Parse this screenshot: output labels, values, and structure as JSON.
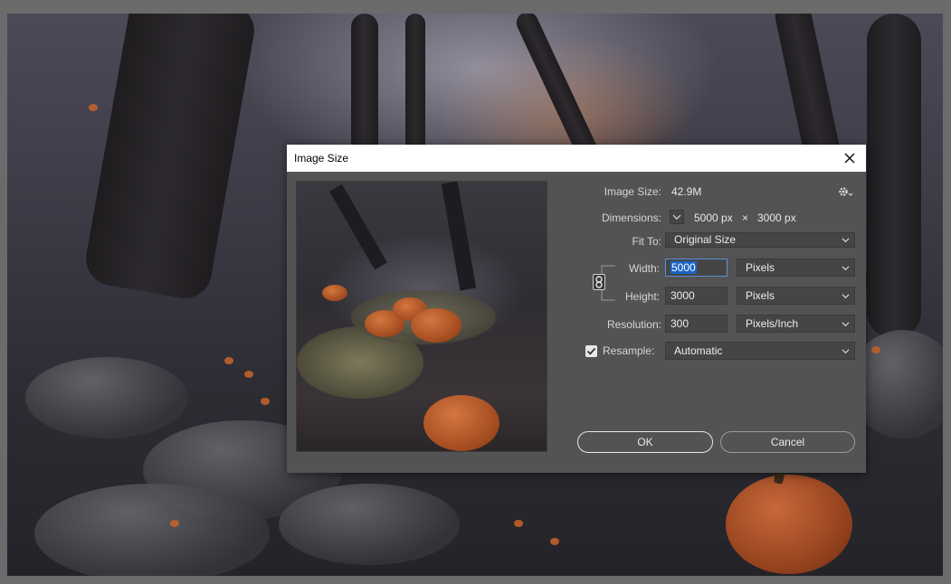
{
  "dialog": {
    "title": "Image Size",
    "image_size_label": "Image Size:",
    "image_size_value": "42.9M",
    "dimensions_label": "Dimensions:",
    "dim_width": "5000 px",
    "dim_x": "×",
    "dim_height": "3000 px",
    "fit_to_label": "Fit To:",
    "fit_to_value": "Original Size",
    "width_label": "Width:",
    "width_value": "5000",
    "width_unit": "Pixels",
    "height_label": "Height:",
    "height_value": "3000",
    "height_unit": "Pixels",
    "resolution_label": "Resolution:",
    "resolution_value": "300",
    "resolution_unit": "Pixels/Inch",
    "resample_label": "Resample:",
    "resample_value": "Automatic",
    "resample_checked": true,
    "ok_label": "OK",
    "cancel_label": "Cancel"
  },
  "icons": {
    "close": "close-icon",
    "gear": "gear-icon",
    "chevron": "chevron-down-icon",
    "link": "link-chain-icon",
    "check": "checkmark-icon"
  },
  "colors": {
    "dialog_bg": "#535353",
    "field_bg": "#454545",
    "selection": "#1c64c6",
    "accent_orange": "#c8683a"
  }
}
